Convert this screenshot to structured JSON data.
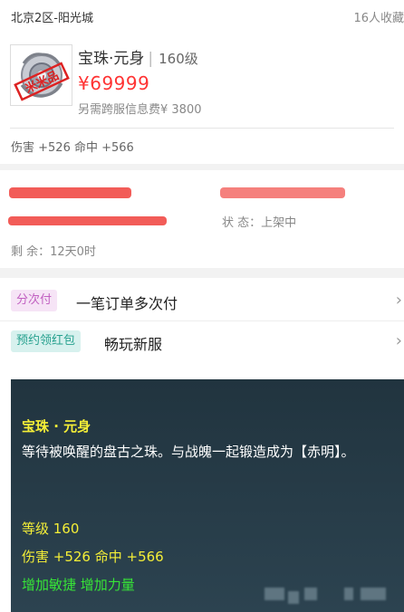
{
  "header": {
    "server": "北京2区-阳光城",
    "favorites": "16人收藏"
  },
  "item": {
    "name": "宝珠·元身",
    "level": "160级",
    "price": "¥69999",
    "cross_fee": "另需跨服信息费¥ 3800",
    "stats": "伤害 +526 命中 +566",
    "badge_stamp": "米米品"
  },
  "listing": {
    "status": "状 态：上架中",
    "remaining": "剩 余：12天0时"
  },
  "promos": [
    {
      "tag": "分次付",
      "label": "一笔订单多次付",
      "color": "#c160c1"
    },
    {
      "tag": "预约领红包",
      "label": "畅玩新服",
      "color": "#27a18f"
    }
  ],
  "description": {
    "title": "宝珠 · 元身",
    "text": "等待被唤醒的盘古之珠。与战魄一起锻造成为【赤明】。",
    "level": "等级 160",
    "stats": "伤害 +526 命中 +566",
    "bonus": "增加敏捷 增加力量"
  },
  "colors": {
    "price": "#ff3333",
    "panel_bg": "#2a3f4c",
    "yellow_text": "#f5ef37",
    "green_text": "#37e537"
  },
  "icons": [
    "chevron-right-icon",
    "item-thumbnail"
  ]
}
